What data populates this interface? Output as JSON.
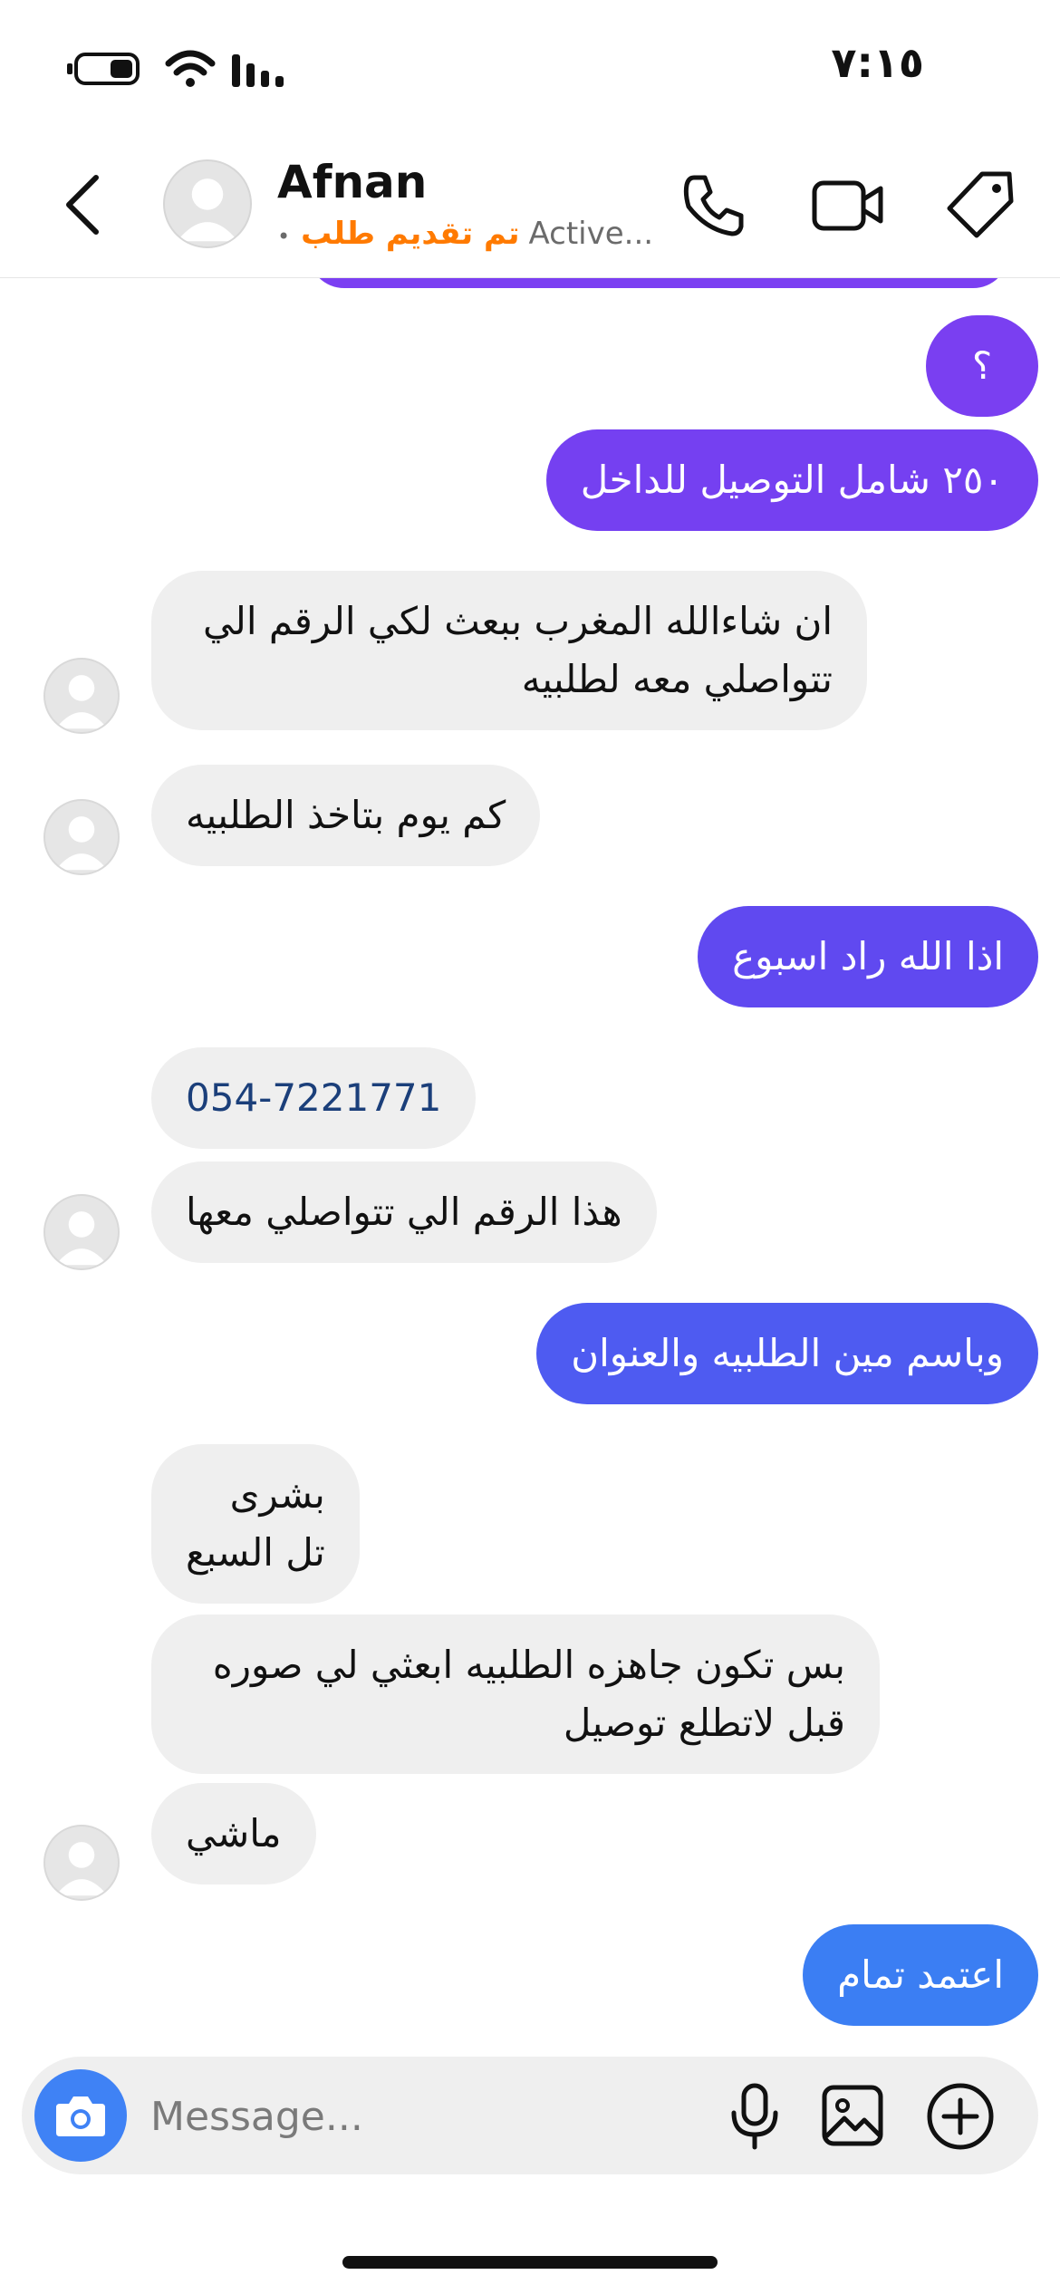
{
  "status_bar": {
    "time": "٧:١٥"
  },
  "header": {
    "name": "Afnan",
    "status_tag": "تم تقديم طلب",
    "status_text": "Active...",
    "dot": "•"
  },
  "messages": [
    {
      "sender": "me",
      "text": "؟",
      "color": "#7a3ff1"
    },
    {
      "sender": "me",
      "text": "٢٥٠ شامل التوصيل للداخل",
      "color": "#7540f1"
    },
    {
      "sender": "them",
      "text": "ان شاءالله المغرب ببعث لكي الرقم الي\nتتواصلي معه لطلبيه"
    },
    {
      "sender": "them",
      "text": "كم يوم بتاخذ الطلبيه"
    },
    {
      "sender": "me",
      "text": "اذا الله راد اسبوع",
      "color": "#6049f0"
    },
    {
      "sender": "them",
      "text": "054-7221771",
      "is_phone": true
    },
    {
      "sender": "them",
      "text": "هذا الرقم الي تتواصلي معها"
    },
    {
      "sender": "me",
      "text": "وباسم مين الطلبيه والعنوان",
      "color": "#4e5bf1"
    },
    {
      "sender": "them",
      "text": "بشرى\nتل السبع"
    },
    {
      "sender": "them",
      "text": "بس تكون جاهزه الطلبيه ابعثي لي صوره\nقبل لاتطلع توصيل"
    },
    {
      "sender": "them",
      "text": "ماشي"
    },
    {
      "sender": "me",
      "text": "اعتمد تمام",
      "color": "#3b7ef3"
    }
  ],
  "composer": {
    "placeholder": "Message..."
  }
}
